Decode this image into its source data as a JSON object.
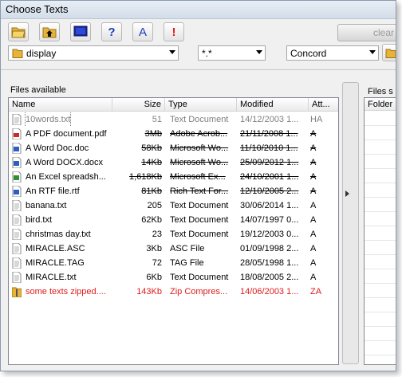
{
  "window": {
    "title": "Choose Texts"
  },
  "toolbar": {
    "buttons": [
      {
        "name": "open-folder-button",
        "icon": "folder-open-icon"
      },
      {
        "name": "up-folder-button",
        "icon": "folder-up-icon"
      },
      {
        "name": "view-button",
        "icon": "monitor-icon"
      },
      {
        "name": "help-button",
        "icon": "question-icon",
        "glyph": "?"
      },
      {
        "name": "font-button",
        "icon": "letter-a-icon",
        "glyph": "A"
      },
      {
        "name": "alert-button",
        "icon": "exclamation-icon",
        "glyph": "!"
      }
    ],
    "clear_label": "clear"
  },
  "filters": {
    "folder": "display",
    "mask": "*.*",
    "program": "Concord"
  },
  "files_available": {
    "label": "Files available",
    "columns": [
      "Name",
      "Size",
      "Type",
      "Modified",
      "Att..."
    ],
    "rows": [
      {
        "name": "10words.txt",
        "size": "51",
        "type": "Text Document",
        "modified": "14/12/2003 1...",
        "att": "HA",
        "style": "dim",
        "icon": "text-file-icon"
      },
      {
        "name": "A PDF document.pdf",
        "size": "3Mb",
        "type": "Adobe Acrob...",
        "modified": "21/11/2008 1...",
        "att": "A",
        "style": "del",
        "icon": "pdf-file-icon"
      },
      {
        "name": "A Word Doc.doc",
        "size": "58Kb",
        "type": "Microsoft Wo...",
        "modified": "11/10/2010 1...",
        "att": "A",
        "style": "del",
        "icon": "word-file-icon"
      },
      {
        "name": "A Word DOCX.docx",
        "size": "14Kb",
        "type": "Microsoft Wo...",
        "modified": "25/09/2012 1...",
        "att": "A",
        "style": "del",
        "icon": "word-file-icon"
      },
      {
        "name": "An Excel spreadsh...",
        "size": "1,618Kb",
        "type": "Microsoft Ex...",
        "modified": "24/10/2001 1...",
        "att": "A",
        "style": "del",
        "icon": "excel-file-icon"
      },
      {
        "name": "An RTF file.rtf",
        "size": "81Kb",
        "type": "Rich Text For...",
        "modified": "12/10/2005 2...",
        "att": "A",
        "style": "del",
        "icon": "word-file-icon"
      },
      {
        "name": "banana.txt",
        "size": "205",
        "type": "Text Document",
        "modified": "30/06/2014 1...",
        "att": "A",
        "style": "normal",
        "icon": "text-file-icon"
      },
      {
        "name": "bird.txt",
        "size": "62Kb",
        "type": "Text Document",
        "modified": "14/07/1997 0...",
        "att": "A",
        "style": "normal",
        "icon": "text-file-icon"
      },
      {
        "name": "christmas day.txt",
        "size": "23",
        "type": "Text Document",
        "modified": "19/12/2003 0...",
        "att": "A",
        "style": "normal",
        "icon": "text-file-icon"
      },
      {
        "name": "MIRACLE.ASC",
        "size": "3Kb",
        "type": "ASC File",
        "modified": "01/09/1998 2...",
        "att": "A",
        "style": "normal",
        "icon": "text-file-icon"
      },
      {
        "name": "MIRACLE.TAG",
        "size": "72",
        "type": "TAG File",
        "modified": "28/05/1998 1...",
        "att": "A",
        "style": "normal",
        "icon": "text-file-icon"
      },
      {
        "name": "MIRACLE.txt",
        "size": "6Kb",
        "type": "Text Document",
        "modified": "18/08/2005 2...",
        "att": "A",
        "style": "normal",
        "icon": "text-file-icon"
      },
      {
        "name": "some texts zipped....",
        "size": "143Kb",
        "type": "Zip Compres...",
        "modified": "14/06/2003 1...",
        "att": "ZA",
        "style": "red",
        "icon": "zip-folder-icon"
      }
    ]
  },
  "files_selected": {
    "label": "Files s",
    "column": "Folder"
  }
}
